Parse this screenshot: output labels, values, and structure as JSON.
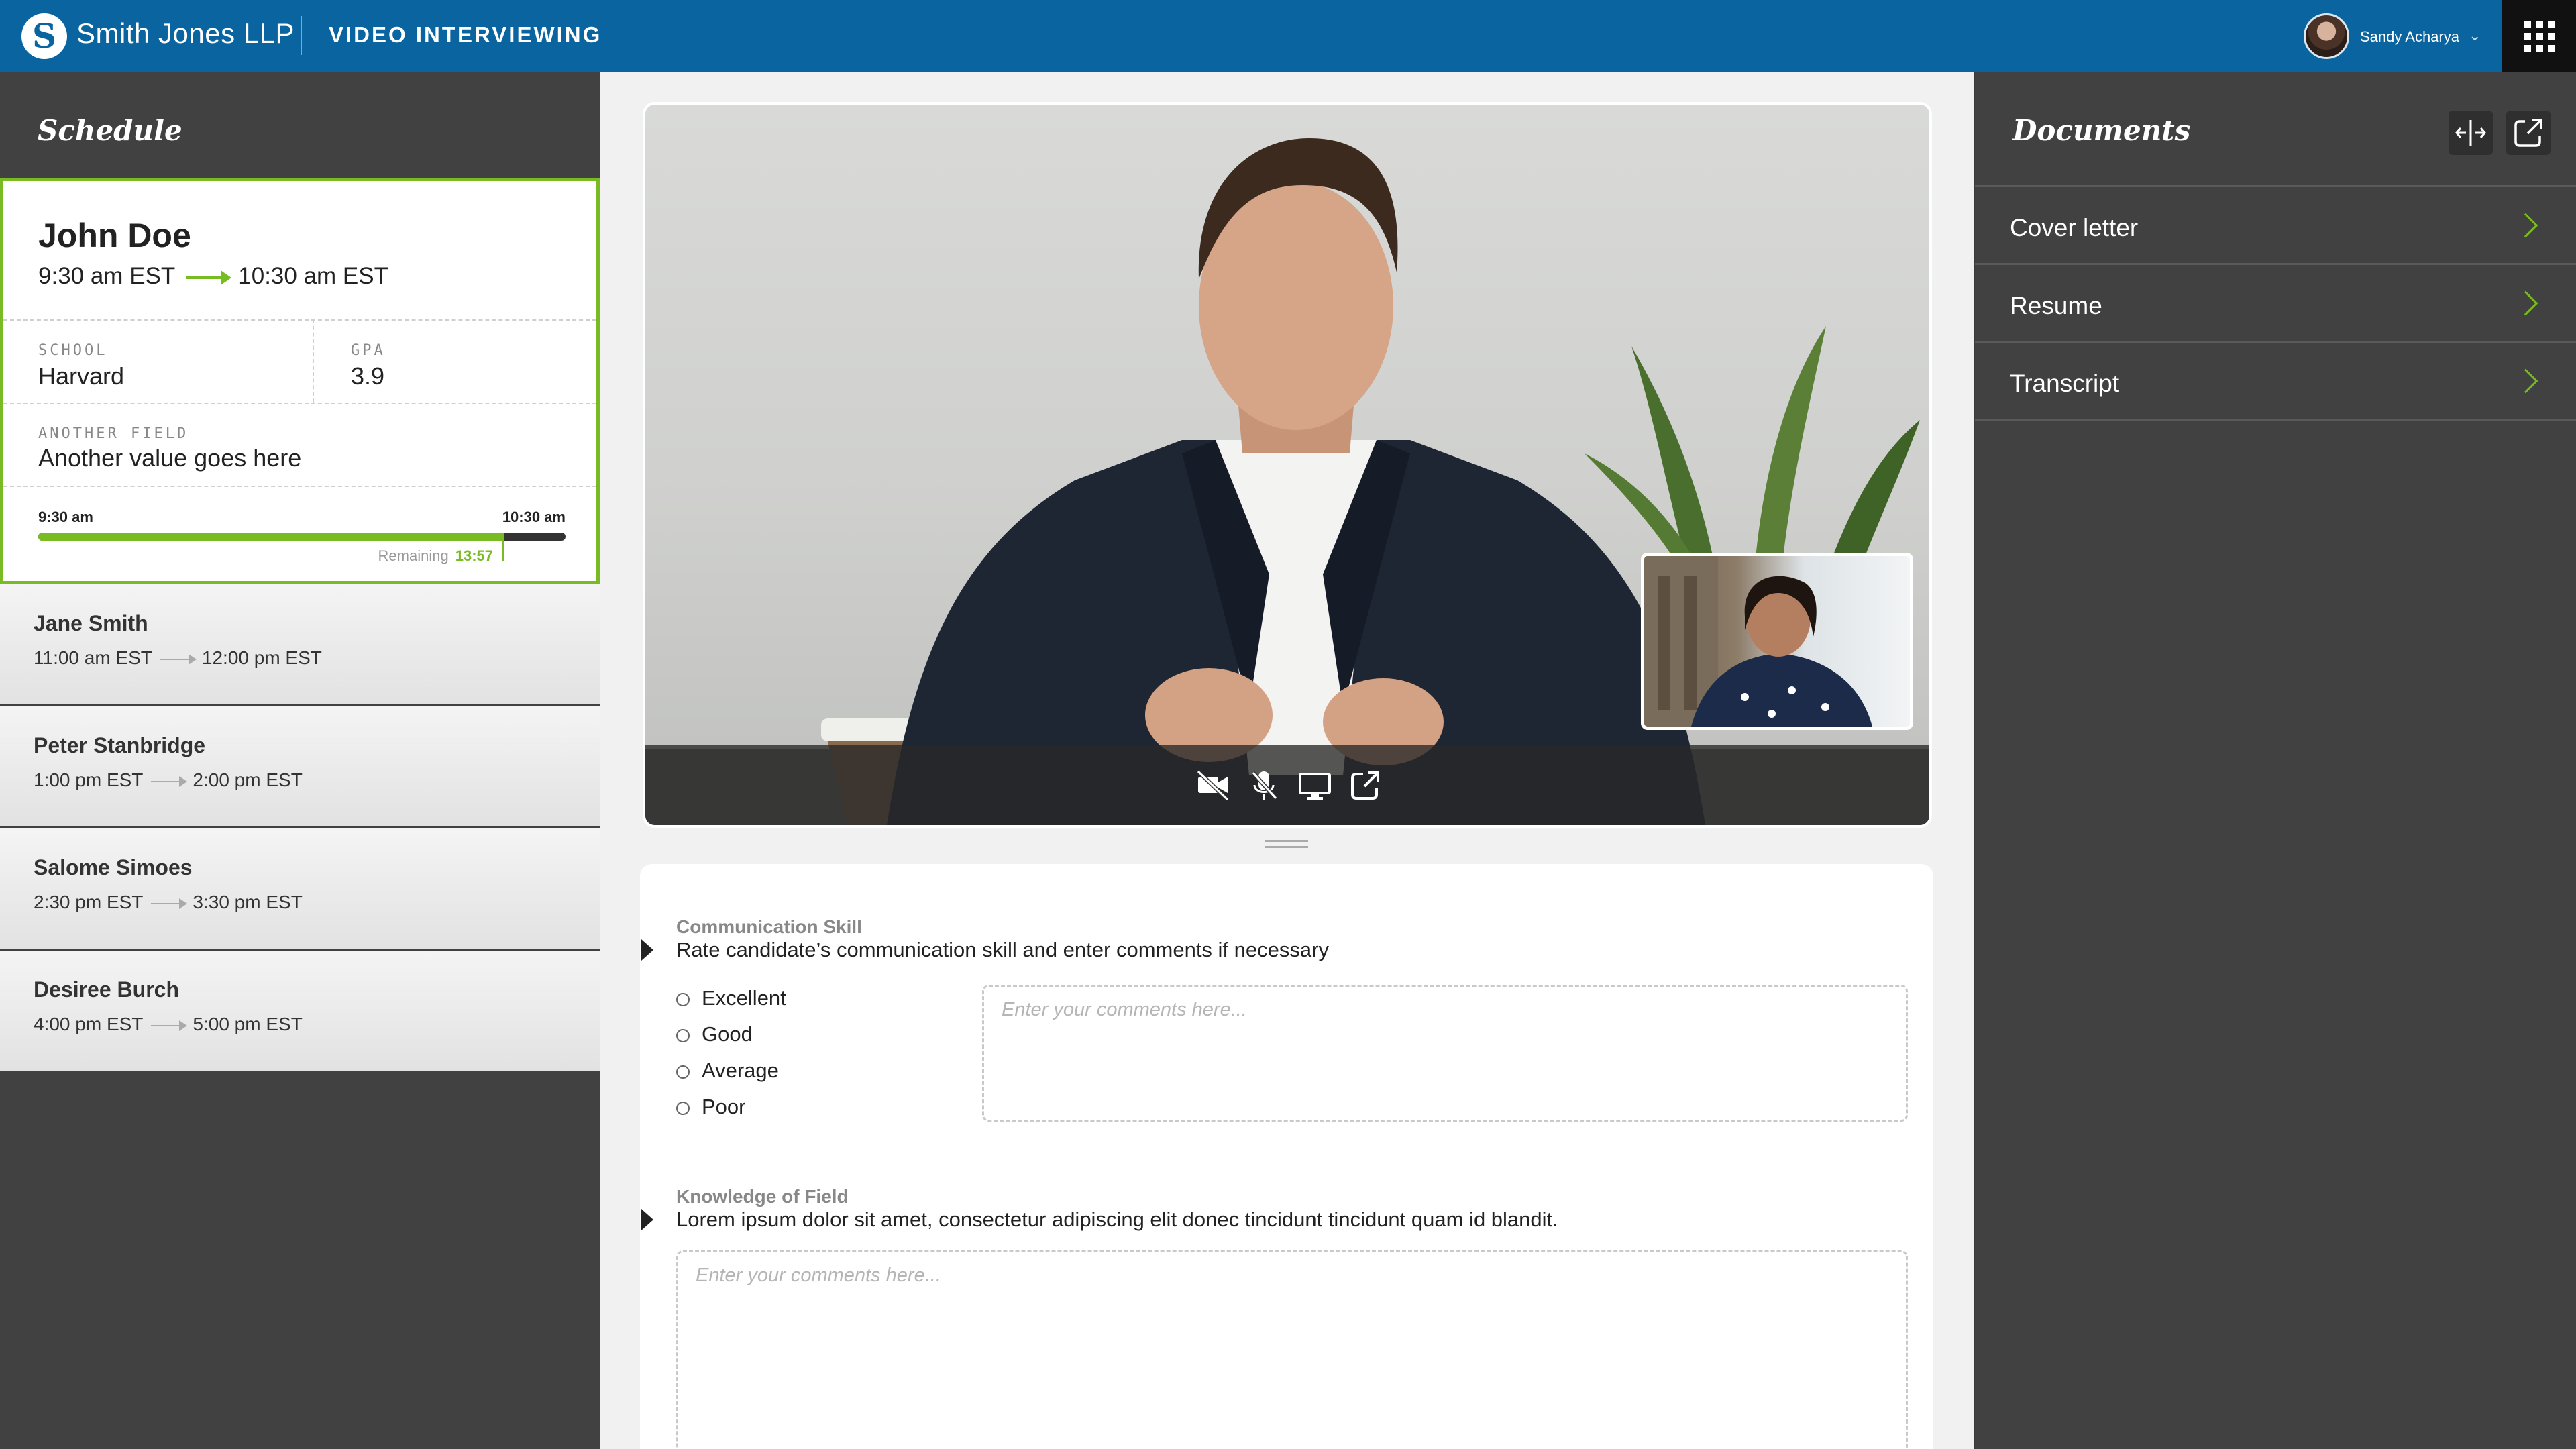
{
  "header": {
    "logo_letter": "S",
    "firm_name": "Smith Jones LLP",
    "app_title": "VIDEO INTERVIEWING",
    "user_name": "Sandy Acharya",
    "user_menu_icon": "chevron-down-icon",
    "apps_icon": "grid-icon"
  },
  "schedule": {
    "title": "Schedule",
    "active": {
      "name": "John Doe",
      "start": "9:30 am EST",
      "end": "10:30 am EST",
      "fields": [
        {
          "label": "SCHOOL",
          "value": "Harvard"
        },
        {
          "label": "GPA",
          "value": "3.9"
        },
        {
          "label": "ANOTHER FIELD",
          "value": "Another value goes here"
        }
      ],
      "timeline": {
        "start": "9:30 am",
        "end": "10:30 am",
        "remaining_label": "Remaining",
        "remaining_value": "13:57",
        "progress_fraction": 0.88
      }
    },
    "items": [
      {
        "name": "Jane Smith",
        "start": "11:00 am EST",
        "end": "12:00 pm EST"
      },
      {
        "name": "Peter Stanbridge",
        "start": "1:00 pm EST",
        "end": "2:00 pm EST"
      },
      {
        "name": "Salome Simoes",
        "start": "2:30 pm EST",
        "end": "3:30 pm EST"
      },
      {
        "name": "Desiree Burch",
        "start": "4:00 pm EST",
        "end": "5:00 pm EST"
      }
    ]
  },
  "video": {
    "controls": [
      "camera-off-icon",
      "mic-off-icon",
      "screen-share-icon",
      "popout-icon"
    ]
  },
  "evaluation": {
    "q1": {
      "label": "Communication Skill",
      "prompt": "Rate candidate’s communication skill and enter comments if necessary",
      "options": [
        "Excellent",
        "Good",
        "Average",
        "Poor"
      ],
      "placeholder": "Enter your comments here..."
    },
    "q2": {
      "label": "Knowledge of Field",
      "prompt": "Lorem ipsum dolor sit amet, consectetur adipiscing elit donec tincidunt tincidunt quam id blandit.",
      "placeholder": "Enter your comments here..."
    }
  },
  "documents": {
    "title": "Documents",
    "tools": [
      "split-view-icon",
      "external-link-icon"
    ],
    "items": [
      {
        "label": "Cover letter"
      },
      {
        "label": "Resume"
      },
      {
        "label": "Transcript"
      }
    ]
  },
  "colors": {
    "brand_blue": "#0a64a0",
    "accent_green": "#78bb22",
    "panel_dark": "#414141"
  }
}
